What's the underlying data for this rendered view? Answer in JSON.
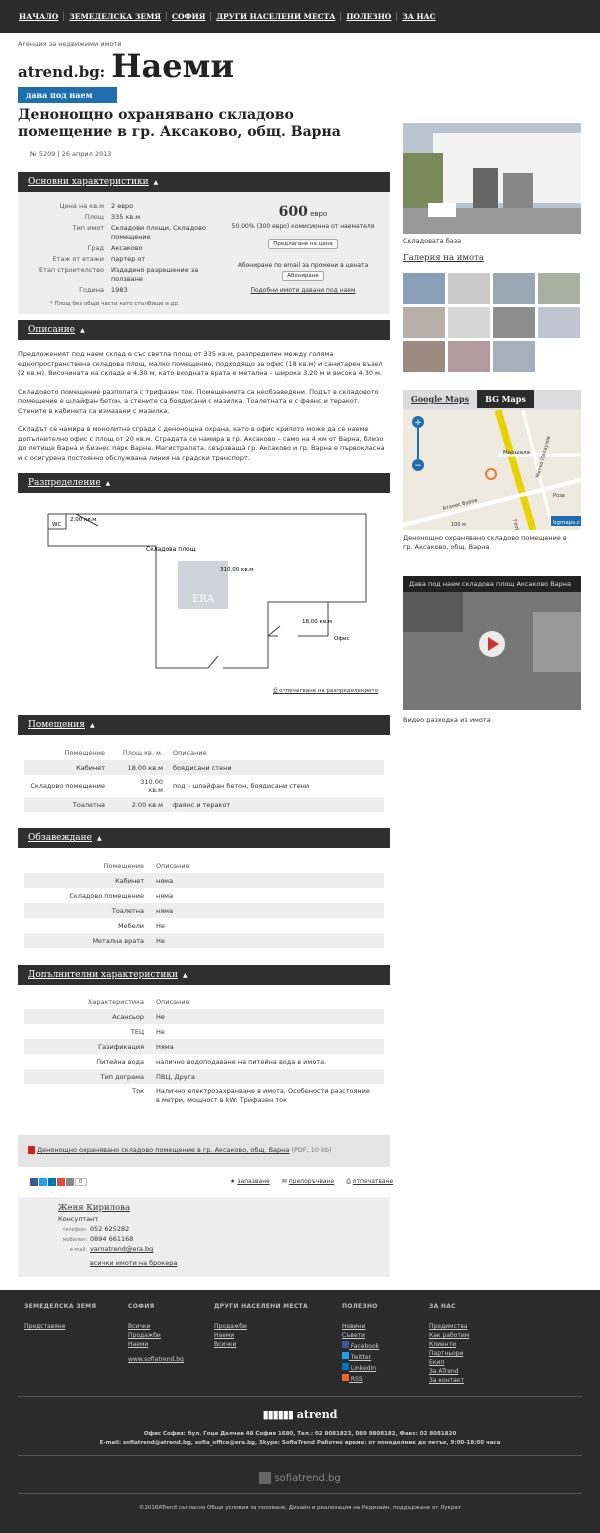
{
  "nav": [
    "НАЧАЛО",
    "ЗЕМЕДЕЛСКА ЗЕМЯ",
    "СОФИЯ",
    "ДРУГИ НАСЕЛЕНИ МЕСТА",
    "ПОЛЕЗНО",
    "ЗА НАС"
  ],
  "brand": {
    "tagline": "Агенция за недвижими имоти",
    "site": "atrend.bg:",
    "section": "Наеми"
  },
  "badge": "дава под наем",
  "title": "Денонощно охранявано складово помещение в гр. Аксаково, общ. Варна",
  "meta": "№ 5209 | 26 април 2013",
  "sections": {
    "main": "Основни характеристики",
    "desc": "Описание",
    "layout": "Разпределение",
    "rooms": "Помещения",
    "furn": "Обзавеждане",
    "extra": "Допълнителни характеристики"
  },
  "chars": [
    {
      "k": "Цена на кв.м",
      "v": "2 евро"
    },
    {
      "k": "Площ",
      "v": "335 кв.м"
    },
    {
      "k": "Тип имот",
      "v": "Складови площи, Складово помещение"
    },
    {
      "k": "Град",
      "v": "Аксаково"
    },
    {
      "k": "Етаж от етажи",
      "v": "партер от"
    },
    {
      "k": "Етап строителство",
      "v": "Издадено разрешение за ползване"
    },
    {
      "k": "Година",
      "v": "1983"
    }
  ],
  "chars_note": "* Площ без общи части като стълбище и др.",
  "price": {
    "amount": "600",
    "currency": "евро",
    "commission": "50.00% (300 евро) комисионна от наемателя",
    "offer_btn": "Предлагане на цена",
    "sub_text": "Абониране по email за промени в цената",
    "sub_btn": "Абониране",
    "similar": "Подобни имоти давани под наем"
  },
  "description": [
    "Предложеният под наем склад е със светла площ от 335 кв.м, разпределен между голяма еднопространствена складова площ, малко помещение, подходящо за офис (18 кв.м) и санитарен възел (2 кв.м). Височината на склада е 4.30 м, като входната врата е метална – широка 3.20 м и висока 4.30 м.",
    "Складовото помещение разполага с трифазен ток. Помещенията са необзаведени. Подът в складовото помещение е шлайфан бетон, а стените са боядисани с мазилка. Тоалетната е с фаянс и теракот. Стените в кабинета са измазани с мазилка.",
    "Складът се намира в монолитна сграда с денонощна охрана, като в офис крилото може да се наеме допълнително офис с площ от 20 кв.м. Сградата се намира в гр. Аксаково – само на 4 км от Варна, близо до летище Варна и Бизнес парк Варна. Магистралата, свързваща гр. Аксаково и гр. Варна е първокласна и с осигурена постоянно обслужвана линия на градски транспорт."
  ],
  "floorplan": {
    "wc": "WC",
    "wc_area": "2,00 кв.м",
    "main": "Складова площ",
    "main_area": "310,00 кв.м",
    "office_area": "18,00 кв.м",
    "office": "Офис",
    "era": "ERA",
    "print": "отпечатване на разпределението"
  },
  "rooms": {
    "headers": [
      "Помещение",
      "Площ кв. м.",
      "Описание"
    ],
    "rows": [
      [
        "Кабинет",
        "18.00 кв.м",
        "боядисани стени"
      ],
      [
        "Складово помещение",
        "310.00 кв.м",
        "под - шлайфан бетон, боядисани стени"
      ],
      [
        "Тоалетна",
        "2.00 кв.м",
        "фаянс и теракот"
      ]
    ]
  },
  "furn": {
    "headers": [
      "Помещение",
      "Описание"
    ],
    "rows": [
      [
        "Кабинет",
        "няма"
      ],
      [
        "Складово помещение",
        "няма"
      ],
      [
        "Тоалетна",
        "няма"
      ],
      [
        "Мебели",
        "Не"
      ],
      [
        "Метална врата",
        "Не"
      ]
    ]
  },
  "extra": {
    "headers": [
      "Характеристика",
      "Описание"
    ],
    "rows": [
      [
        "Асансьор",
        "Не"
      ],
      [
        "ТЕЦ",
        "Не"
      ],
      [
        "Газификация",
        "Няма"
      ],
      [
        "Питейна вода",
        "налично водоподаване на питейна вода в имота."
      ],
      [
        "Тип дограма",
        "ПВЦ, Друга"
      ],
      [
        "Ток",
        "Налично електрозахранване в имота, Особености разстояние в метри, мощност в kW: Трифазен ток"
      ]
    ]
  },
  "pdf": {
    "link": "Денонощно охранявано складово помещение в гр. Аксаково, общ. Варна",
    "info": "(PDF, 10 kb)"
  },
  "social_count": "0",
  "actions": [
    "запазване",
    "препоръчване",
    "отпечатване"
  ],
  "agent": {
    "name": "Женя Кирилова",
    "role": "Консултант",
    "phone_label": "телефон:",
    "phone": "052 625282",
    "mobile_label": "мобилен:",
    "mobile": "0894 661168",
    "email_label": "e-mail:",
    "email": "varnatrend@era.bg",
    "all": "всички имоти на брокера"
  },
  "side": {
    "photo_caption": "Складовата база",
    "gallery": "Галерия на имота",
    "map_tab1": "Google Maps",
    "map_tab2": "BG Maps",
    "map_caption": "Денонощно охранявано складово помещение в гр. Аксаково, общ. Варна",
    "map_scale": "100 м",
    "map_brand": "bgmaps.c",
    "streets": [
      "Маршала",
      "Митко Палаузов",
      "Атанас Буров",
      "Роза",
      "Георги"
    ],
    "video_title": "Дава под наем складова площ Аксаково Варна",
    "video_caption": "Видео разходка из имота"
  },
  "footer": {
    "cols": [
      {
        "t": "ЗЕМЕДЕЛСКА ЗЕМЯ",
        "items": [
          "Представяне"
        ]
      },
      {
        "t": "СОФИЯ",
        "items": [
          "Всички",
          "Продажби",
          "Наеми",
          "",
          "www.sofiatrend.bg"
        ]
      },
      {
        "t": "ДРУГИ НАСЕЛЕНИ МЕСТА",
        "items": [
          "Продажби",
          "Наеми",
          "Всички"
        ]
      },
      {
        "t": "ПОЛЕЗНО",
        "items": [
          "Новини",
          "Съвети",
          "Facebook",
          "Twitter",
          "LinkedIn",
          "RSS"
        ]
      },
      {
        "t": "ЗА НАС",
        "items": [
          "Предимства",
          "Как работим",
          "Клиенти",
          "Партньори",
          "Екип",
          "За ATrend",
          "За контакт"
        ]
      }
    ],
    "logo": "atrend",
    "office": "Офис София: бул. Гоце Делчев 48 София 1680, Тел.: 02 8081823, 089 9808182, Факс: 02 8081820",
    "contact": "E-mail: sofiatrend@atrend.bg, sofia_office@era.bg, Skype: SofiaTrend Работно време: от понеделник до петък, 9:00-18:00 часа",
    "sofia": "sofiatrend.bg",
    "copy": "©2016ATrend съгласно Общи условия за ползване, Дизайн и реализация на Редизайн, поддържане от Лукрат"
  },
  "colors": {
    "dark": "#2b2b2b",
    "accent": "#1f6fae"
  }
}
